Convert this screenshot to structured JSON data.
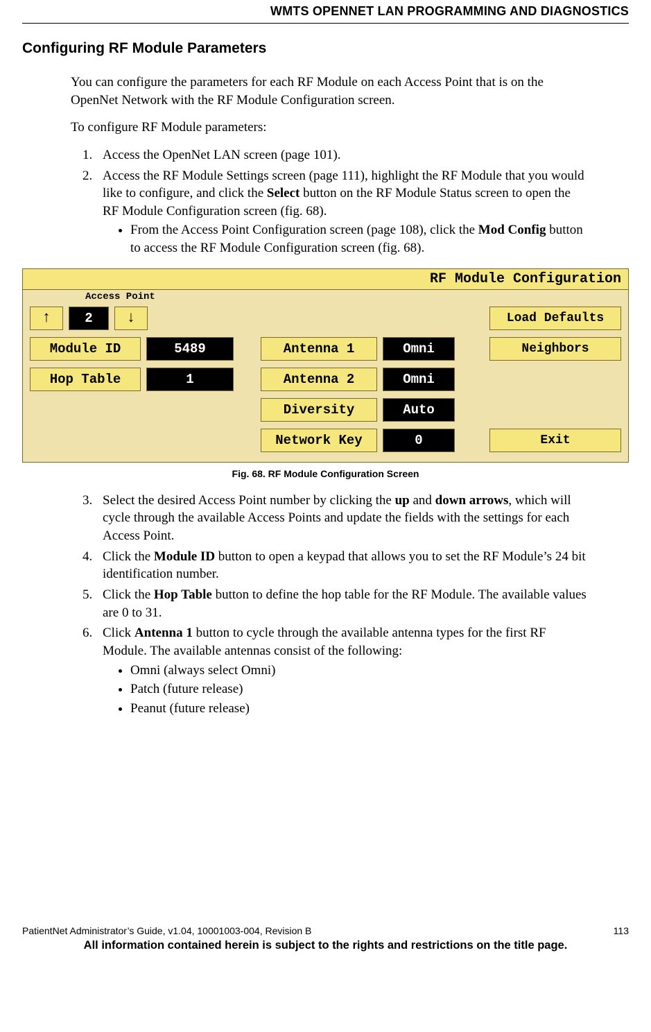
{
  "header": {
    "running": "WMTS OPENNET LAN PROGRAMMING AND DIAGNOSTICS"
  },
  "title": "Configuring RF Module Parameters",
  "intro1": "You can configure the parameters for each RF Module on each Access Point that is on the OpenNet Network with the RF Module Configuration screen.",
  "intro2": "To configure RF Module parameters:",
  "steps_a": {
    "s1": "Access the OpenNet LAN screen (page 101).",
    "s2_a": "Access the RF Module Settings screen (page 111), highlight the RF Module that you would like to configure, and click the ",
    "s2_bold": "Select",
    "s2_b": " button on the RF Module Status screen to open the RF Module Configuration screen (fig. 68).",
    "s2_sub_a": "From the Access Point Configuration screen (page 108), click the ",
    "s2_sub_bold": "Mod Config",
    "s2_sub_b": " button to access the RF Module Configuration screen (fig. 68)."
  },
  "figure": {
    "title": "RF Module Configuration",
    "ap_label": "Access Point",
    "ap_value": "2",
    "up": "↑",
    "down": "↓",
    "module_id_label": "Module ID",
    "module_id_value": "5489",
    "hop_table_label": "Hop Table",
    "hop_table_value": "1",
    "antenna1_label": "Antenna 1",
    "antenna1_value": "Omni",
    "antenna2_label": "Antenna 2",
    "antenna2_value": "Omni",
    "diversity_label": "Diversity",
    "diversity_value": "Auto",
    "netkey_label": "Network Key",
    "netkey_value": "0",
    "load_defaults": "Load Defaults",
    "neighbors": "Neighbors",
    "exit": "Exit",
    "caption": "Fig. 68. RF Module Configuration Screen"
  },
  "steps_b": {
    "s3_a": "Select the desired Access Point number by clicking the ",
    "s3_b1": "up",
    "s3_mid": " and ",
    "s3_b2": "down arrows",
    "s3_b": ", which will cycle through the available Access Points and update the fields with the settings for each Access Point.",
    "s4_a": "Click the ",
    "s4_bold": "Module ID",
    "s4_b": " button to open a keypad that allows you to set the RF Module’s 24 bit identification number.",
    "s5_a": "Click the ",
    "s5_bold": "Hop Table",
    "s5_b": " button to define the hop table for the RF Module. The available values are 0 to 31.",
    "s6_a": "Click ",
    "s6_bold": "Antenna 1",
    "s6_b": " button to cycle through the available antenna types for the first RF Module. The available antennas consist of the following:",
    "s6_li1": "Omni (always select Omni)",
    "s6_li2": "Patch (future release)",
    "s6_li3": "Peanut (future release)"
  },
  "footer": {
    "left": "PatientNet Administrator’s Guide, v1.04, 10001003-004, Revision B",
    "right": "113",
    "rights": "All information contained herein is subject to the rights and restrictions on the title page."
  }
}
